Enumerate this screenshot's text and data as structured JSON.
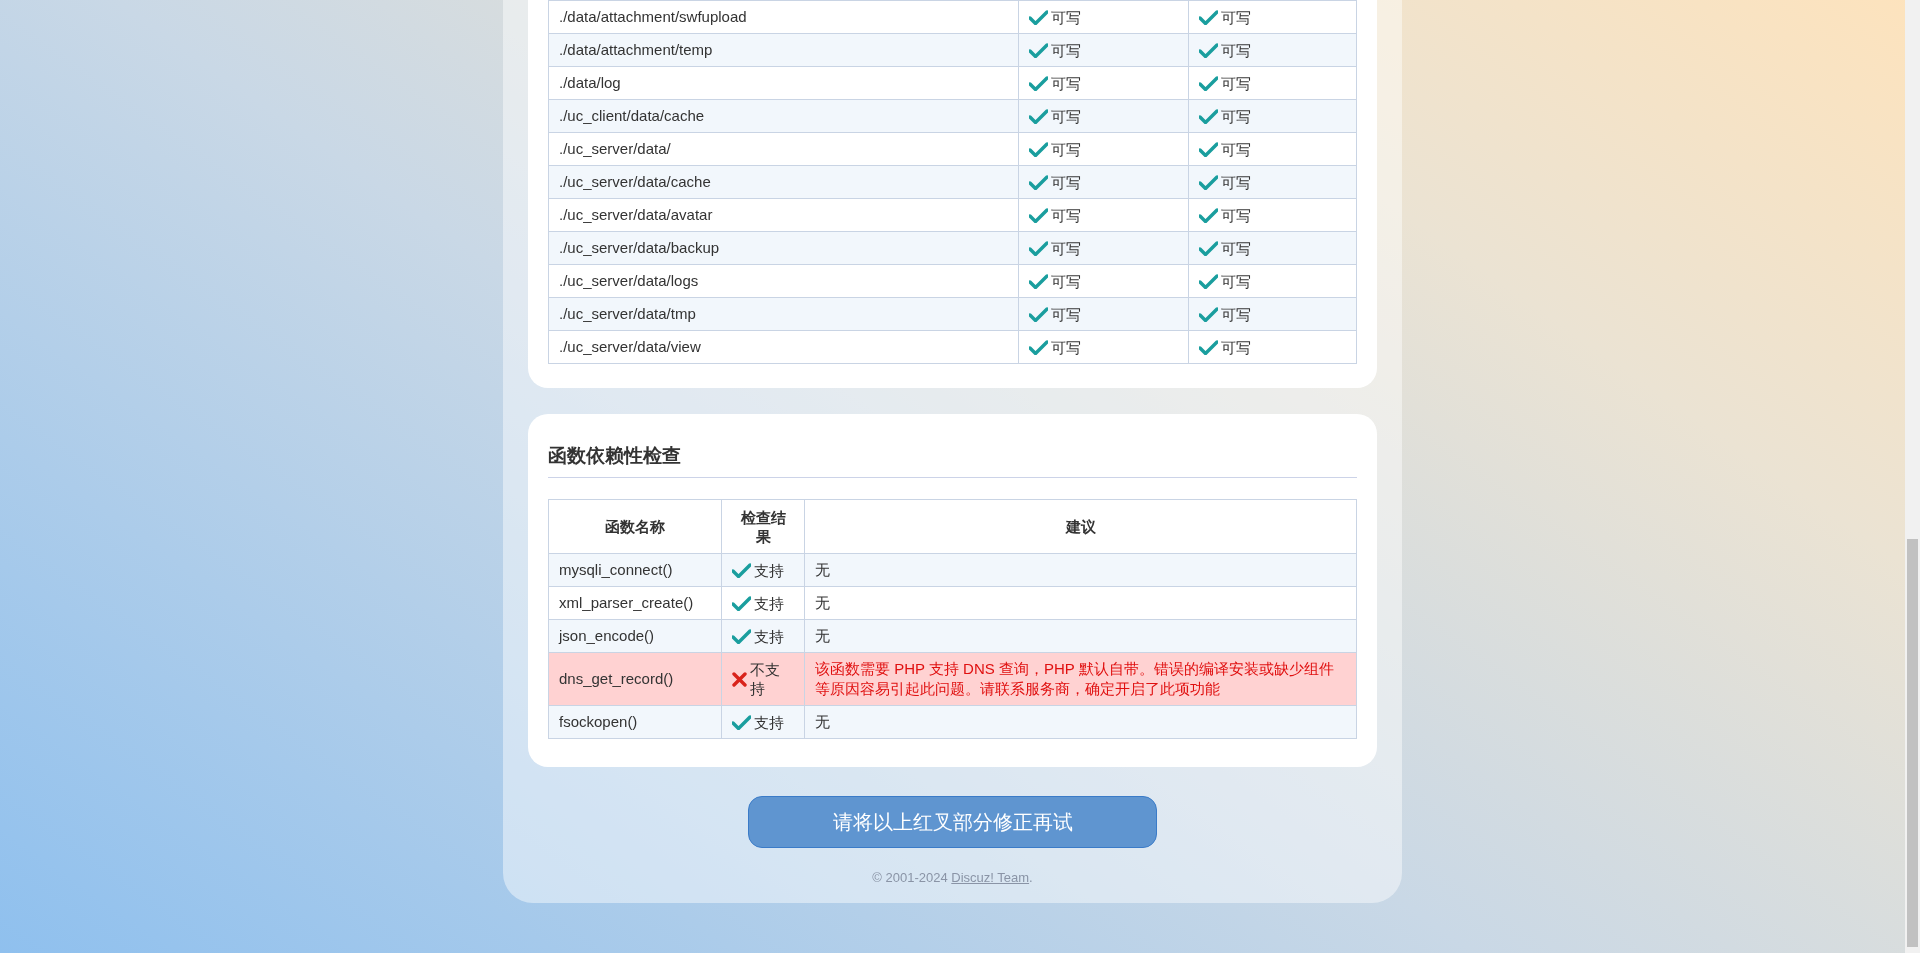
{
  "directory_table": {
    "rows": [
      {
        "path": "./data/attachment/swfupload",
        "column_2": {
          "text": "可写",
          "ok": true
        },
        "column_3": {
          "text": "可写",
          "ok": true
        }
      },
      {
        "path": "./data/attachment/temp",
        "column_2": {
          "text": "可写",
          "ok": true
        },
        "column_3": {
          "text": "可写",
          "ok": true
        }
      },
      {
        "path": "./data/log",
        "column_2": {
          "text": "可写",
          "ok": true
        },
        "column_3": {
          "text": "可写",
          "ok": true
        }
      },
      {
        "path": "./uc_client/data/cache",
        "column_2": {
          "text": "可写",
          "ok": true
        },
        "column_3": {
          "text": "可写",
          "ok": true
        }
      },
      {
        "path": "./uc_server/data/",
        "column_2": {
          "text": "可写",
          "ok": true
        },
        "column_3": {
          "text": "可写",
          "ok": true
        }
      },
      {
        "path": "./uc_server/data/cache",
        "column_2": {
          "text": "可写",
          "ok": true
        },
        "column_3": {
          "text": "可写",
          "ok": true
        }
      },
      {
        "path": "./uc_server/data/avatar",
        "column_2": {
          "text": "可写",
          "ok": true
        },
        "column_3": {
          "text": "可写",
          "ok": true
        }
      },
      {
        "path": "./uc_server/data/backup",
        "column_2": {
          "text": "可写",
          "ok": true
        },
        "column_3": {
          "text": "可写",
          "ok": true
        }
      },
      {
        "path": "./uc_server/data/logs",
        "column_2": {
          "text": "可写",
          "ok": true
        },
        "column_3": {
          "text": "可写",
          "ok": true
        }
      },
      {
        "path": "./uc_server/data/tmp",
        "column_2": {
          "text": "可写",
          "ok": true
        },
        "column_3": {
          "text": "可写",
          "ok": true
        }
      },
      {
        "path": "./uc_server/data/view",
        "column_2": {
          "text": "可写",
          "ok": true
        },
        "column_3": {
          "text": "可写",
          "ok": true
        }
      }
    ]
  },
  "function_check": {
    "title": "函数依赖性检查",
    "columns": [
      "函数名称",
      "检查结果",
      "建议"
    ],
    "rows": [
      {
        "name": "mysqli_connect()",
        "result": {
          "text": "支持",
          "ok": true
        },
        "advice": "无"
      },
      {
        "name": "xml_parser_create()",
        "result": {
          "text": "支持",
          "ok": true
        },
        "advice": "无"
      },
      {
        "name": "json_encode()",
        "result": {
          "text": "支持",
          "ok": true
        },
        "advice": "无"
      },
      {
        "name": "dns_get_record()",
        "result": {
          "text": "不支持",
          "ok": false
        },
        "advice": "该函数需要 PHP 支持 DNS 查询，PHP 默认自带。错误的编译安装或缺少组件等原因容易引起此问题。请联系服务商，确定开启了此项功能"
      },
      {
        "name": "fsockopen()",
        "result": {
          "text": "支持",
          "ok": true
        },
        "advice": "无"
      }
    ]
  },
  "retry_button": "请将以上红叉部分修正再试",
  "footer": {
    "prefix": "© 2001-2024 ",
    "link": "Discuz! Team",
    "suffix": "."
  }
}
